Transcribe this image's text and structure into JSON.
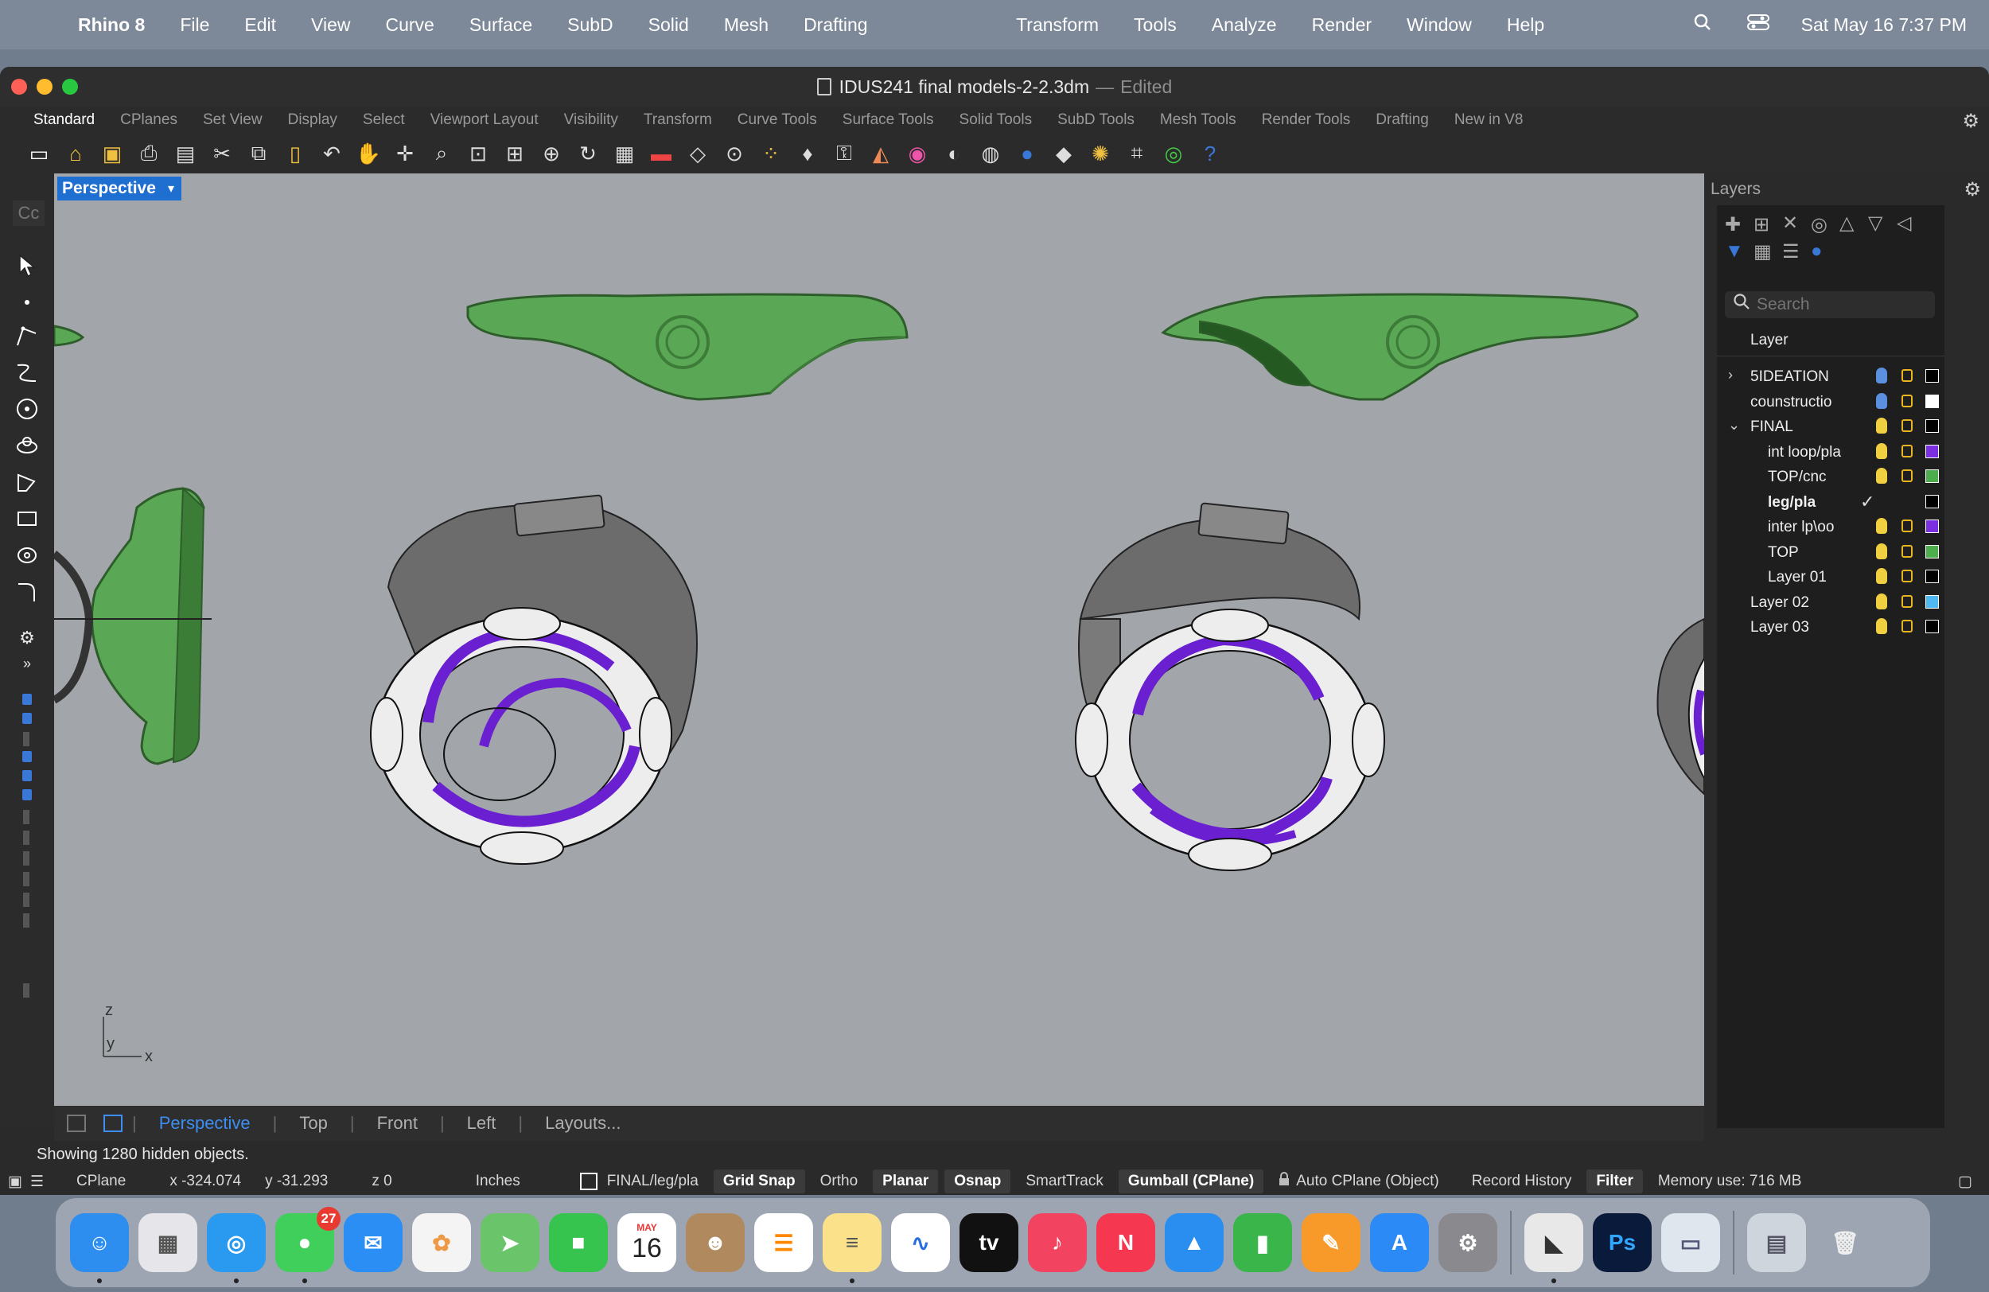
{
  "menubar": {
    "app_name": "Rhino 8",
    "items": [
      "File",
      "Edit",
      "View",
      "Curve",
      "Surface",
      "SubD",
      "Solid",
      "Mesh",
      "Drafting",
      "Transform",
      "Tools",
      "Analyze",
      "Render",
      "Window",
      "Help"
    ],
    "clock": "Sat May 16  7:37 PM"
  },
  "window": {
    "title": "IDUS241 final models-2-2.3dm",
    "title_sep": "—",
    "title_status": "Edited"
  },
  "toolbar_tabs": [
    "Standard",
    "CPlanes",
    "Set View",
    "Display",
    "Select",
    "Viewport Layout",
    "Visibility",
    "Transform",
    "Curve Tools",
    "Surface Tools",
    "Solid Tools",
    "SubD Tools",
    "Mesh Tools",
    "Render Tools",
    "Drafting",
    "New in V8"
  ],
  "toolbar_icons": [
    "new-icon",
    "open-icon",
    "save-icon",
    "print-icon",
    "import-icon",
    "cut-icon",
    "copy-icon",
    "paste-icon",
    "undo-icon",
    "pan-icon",
    "rotate-view-icon",
    "zoom-icon",
    "zoom-window-icon",
    "zoom-extents-icon",
    "zoom-selected-icon",
    "rotate-icon",
    "four-viewports-icon",
    "car-icon",
    "cplane-icon",
    "gumball-icon",
    "points-icon",
    "light-icon",
    "lock-icon",
    "layer-icon",
    "color-wheel-icon",
    "shade-icon",
    "wireframe-icon",
    "render-sphere-icon",
    "rendered-icon",
    "settings-gear-icon",
    "snap-icon",
    "globe-icon",
    "help-icon"
  ],
  "command_prompt": "Cc",
  "viewport": {
    "name": "Perspective",
    "axis": {
      "z": "z",
      "y": "y",
      "x": "x"
    }
  },
  "viewport_tabs": [
    "Perspective",
    "Top",
    "Front",
    "Left",
    "Layouts..."
  ],
  "layers_panel": {
    "title": "Layers",
    "search_placeholder": "Search",
    "column_header": "Layer",
    "rows": [
      {
        "name": "5IDEATION",
        "indent": 0,
        "arrow": "›",
        "bulb": "#5b8fe0",
        "color": "#000000"
      },
      {
        "name": "counstructio",
        "indent": 0,
        "arrow": "",
        "bulb": "#5b8fe0",
        "color": "#ffffff"
      },
      {
        "name": "FINAL",
        "indent": 0,
        "arrow": "⌄",
        "bulb": "#f0d040",
        "color": "#000000"
      },
      {
        "name": "int loop/pla",
        "indent": 1,
        "arrow": "",
        "bulb": "#f0d040",
        "color": "#7a2fe0"
      },
      {
        "name": "TOP/cnc",
        "indent": 1,
        "arrow": "",
        "bulb": "#f0d040",
        "color": "#4cae4c"
      },
      {
        "name": "leg/pla",
        "indent": 1,
        "arrow": "",
        "bulb": "",
        "color": "#000000",
        "current": true
      },
      {
        "name": "inter lp\\oo",
        "indent": 1,
        "arrow": "",
        "bulb": "#f0d040",
        "color": "#7a2fe0"
      },
      {
        "name": "TOP",
        "indent": 1,
        "arrow": "",
        "bulb": "#f0d040",
        "color": "#4cae4c"
      },
      {
        "name": "Layer 01",
        "indent": 1,
        "arrow": "",
        "bulb": "#f0d040",
        "color": "#000000"
      },
      {
        "name": "Layer 02",
        "indent": 0,
        "arrow": "",
        "bulb": "#f0d040",
        "color": "#4fb8f0"
      },
      {
        "name": "Layer 03",
        "indent": 0,
        "arrow": "",
        "bulb": "#f0d040",
        "color": "#000000"
      }
    ],
    "current_mark": "✓"
  },
  "status": {
    "message": "Showing 1280 hidden objects.",
    "cplane": "CPlane",
    "x": "x -324.074",
    "y": "y -31.293",
    "z": "z 0",
    "units": "Inches",
    "layer": "FINAL/leg/pla",
    "grid_snap": "Grid Snap",
    "ortho": "Ortho",
    "planar": "Planar",
    "osnap": "Osnap",
    "smarttrack": "SmartTrack",
    "gumball": "Gumball (CPlane)",
    "auto_cplane": "Auto CPlane (Object)",
    "record_history": "Record History",
    "filter": "Filter",
    "memory": "Memory use: 716 MB"
  },
  "dock": {
    "calendar_month": "MAY",
    "calendar_day": "16",
    "messages_badge": "27",
    "tv_label": "tv",
    "ps_label": "Ps",
    "items": [
      "finder",
      "launchpad",
      "safari",
      "messages",
      "mail",
      "photos",
      "maps",
      "facetime",
      "calendar",
      "contacts",
      "reminders",
      "notes",
      "freeform",
      "tv",
      "music",
      "news",
      "keynote",
      "numbers",
      "pages",
      "app-store",
      "system-settings",
      "rhino",
      "photoshop",
      "preview",
      "screenshots",
      "trash"
    ]
  },
  "colors": {
    "green_part": "#5aa855",
    "purple_loop": "#6a1fd0",
    "accent_blue": "#1f6fd1"
  }
}
